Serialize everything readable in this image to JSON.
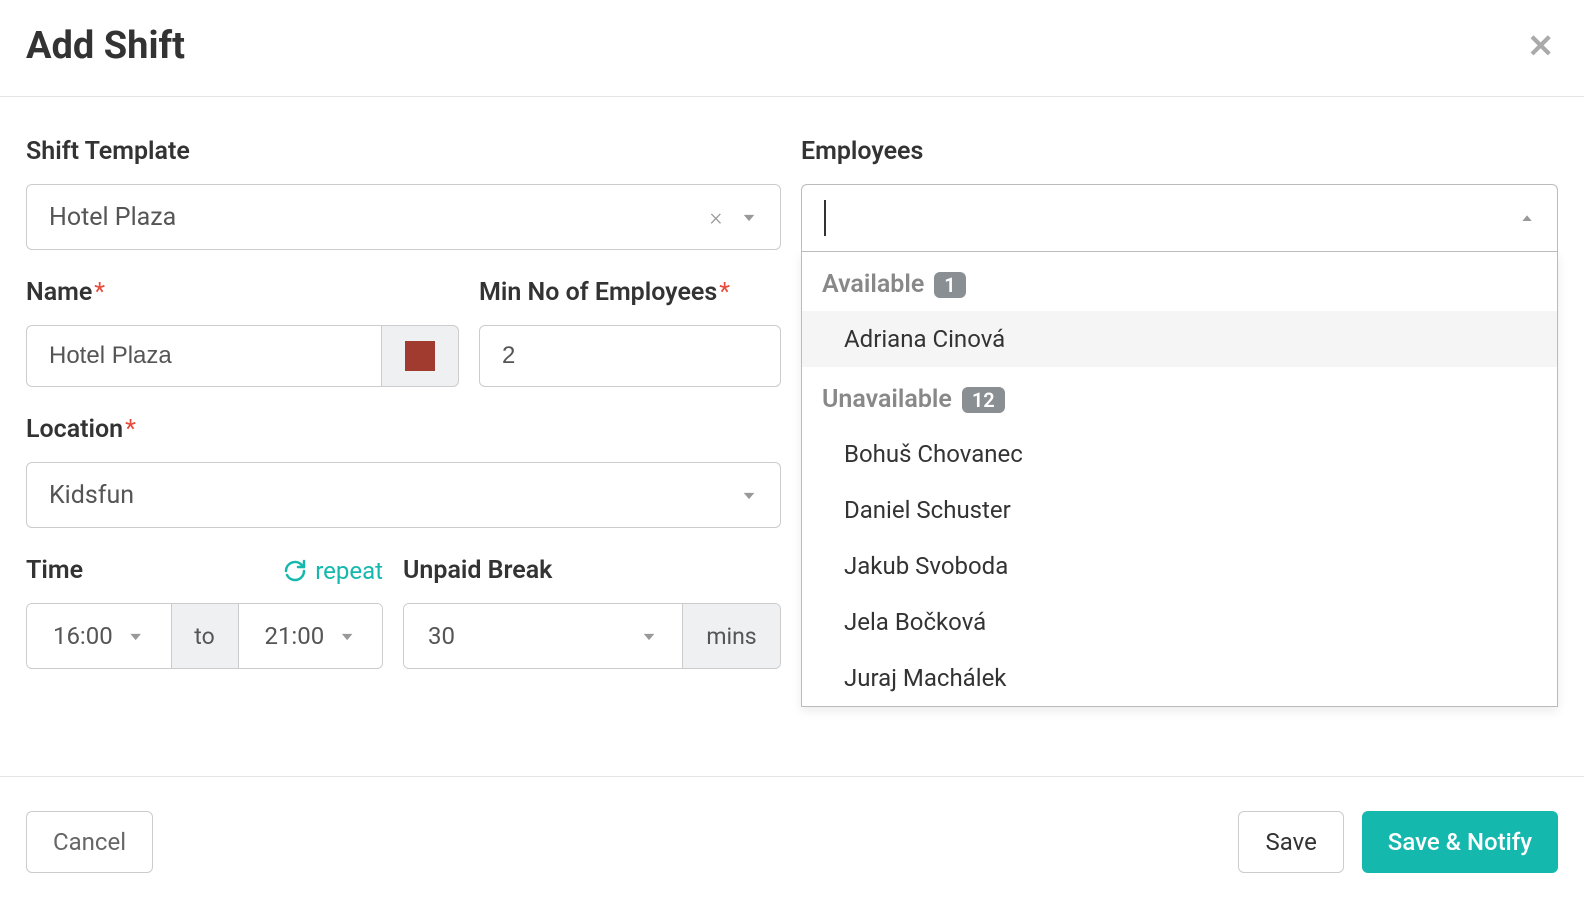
{
  "header": {
    "title": "Add Shift"
  },
  "form": {
    "shiftTemplate": {
      "label": "Shift Template",
      "value": "Hotel Plaza"
    },
    "name": {
      "label": "Name",
      "value": "Hotel Plaza",
      "colorHex": "#a13a2f"
    },
    "minEmployees": {
      "label": "Min No of Employees",
      "value": "2"
    },
    "location": {
      "label": "Location",
      "value": "Kidsfun"
    },
    "time": {
      "label": "Time",
      "repeatLabel": "repeat",
      "from": "16:00",
      "toLabel": "to",
      "to": "21:00"
    },
    "unpaidBreak": {
      "label": "Unpaid Break",
      "value": "30",
      "unit": "mins"
    }
  },
  "employees": {
    "label": "Employees",
    "searchValue": "",
    "groups": {
      "available": {
        "title": "Available",
        "count": "1",
        "items": [
          "Adriana Cinová"
        ]
      },
      "unavailable": {
        "title": "Unavailable",
        "count": "12",
        "items": [
          "Bohuš Chovanec",
          "Daniel Schuster",
          "Jakub Svoboda",
          "Jela Bočková",
          "Juraj Machálek"
        ]
      }
    }
  },
  "footer": {
    "cancel": "Cancel",
    "save": "Save",
    "saveNotify": "Save & Notify"
  }
}
